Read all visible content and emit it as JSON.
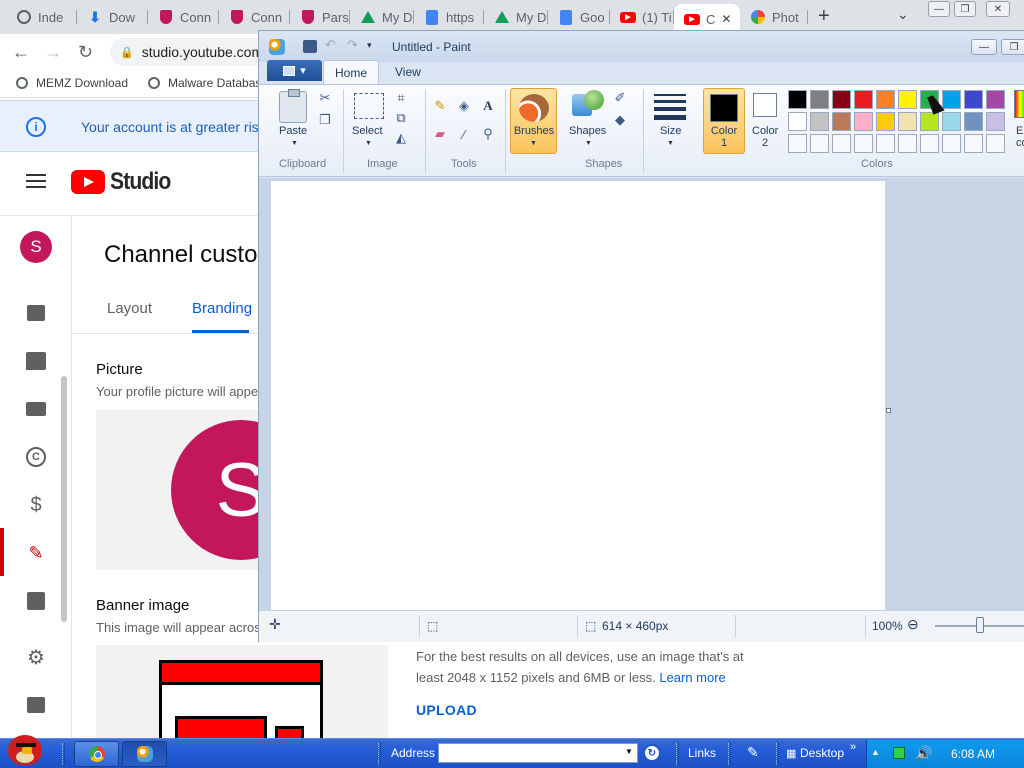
{
  "browser": {
    "tabs": [
      {
        "label": "Inde",
        "icon": "globe-icon"
      },
      {
        "label": "Dow",
        "icon": "download-icon"
      },
      {
        "label": "Conn",
        "icon": "shield-icon"
      },
      {
        "label": "Conn",
        "icon": "shield-icon"
      },
      {
        "label": "Pars",
        "icon": "shield-icon"
      },
      {
        "label": "My D",
        "icon": "drive-icon"
      },
      {
        "label": "https",
        "icon": "docs-icon"
      },
      {
        "label": "My D",
        "icon": "drive-icon"
      },
      {
        "label": "Goo",
        "icon": "docs-icon"
      },
      {
        "label": "(1) Ti",
        "icon": "youtube-icon"
      },
      {
        "label": "C",
        "icon": "youtube-icon",
        "active": true
      },
      {
        "label": "Phot",
        "icon": "photos-icon"
      }
    ],
    "new_tab": "+",
    "tab_menu": "⌄",
    "url": "studio.youtube.com",
    "bookmarks": [
      {
        "label": "MEMZ Download"
      },
      {
        "label": "Malware Databas"
      }
    ],
    "notice": "Your account is at greater risk"
  },
  "studio": {
    "logo_text": "Studio",
    "avatar_letter": "S",
    "page_title": "Channel custor",
    "tabs": [
      "Layout",
      "Branding"
    ],
    "active_tab": "Branding",
    "picture": {
      "heading": "Picture",
      "desc": "Your profile picture will appe",
      "letter": "S"
    },
    "banner": {
      "heading": "Banner image",
      "desc": "This image will appear acros",
      "best_results": "For the best results on all devices, use an image that's at least 2048 x 1152 pixels and 6MB or less.",
      "learn_more": "Learn more",
      "upload": "UPLOAD"
    },
    "rail_icons": [
      "dashboard-icon",
      "comments-icon",
      "subtitles-icon",
      "copyright-icon",
      "monetization-icon",
      "customization-icon",
      "audio-library-icon",
      "settings-icon",
      "feedback-icon"
    ]
  },
  "paint": {
    "title": "Untitled - Paint",
    "tabs": {
      "home": "Home",
      "view": "View"
    },
    "groups": {
      "clipboard": "Clipboard",
      "image": "Image",
      "tools": "Tools",
      "shapes": "Shapes",
      "colors": "Colors"
    },
    "buttons": {
      "paste": "Paste",
      "select": "Select",
      "brushes": "Brushes",
      "shapes": "Shapes",
      "size": "Size",
      "color1": "Color\n1",
      "color1_a": "Color",
      "color1_b": "1",
      "color2_a": "Color",
      "color2_b": "2",
      "edit_a": "E",
      "edit_b": "co"
    },
    "color1": "#000000",
    "color2": "#ffffff",
    "palette_row1": [
      "#000000",
      "#7f7f7f",
      "#880015",
      "#ed1c24",
      "#ff7f27",
      "#fff200",
      "#22b14c",
      "#00a2e8",
      "#3f48cc",
      "#a349a4"
    ],
    "palette_row2": [
      "#ffffff",
      "#c3c3c3",
      "#b97a57",
      "#ffaec9",
      "#ffc90e",
      "#efe4b0",
      "#b5e61d",
      "#99d9ea",
      "#7092be",
      "#c8bfe7"
    ],
    "palette_row3_count": 10,
    "status": {
      "canvas_size": "614 × 460px",
      "zoom": "100%",
      "zoom_level": 0.5
    }
  },
  "taskbar": {
    "address_label": "Address",
    "address_value": "",
    "links_label": "Links",
    "desktop_label": "Desktop",
    "clock": "6:08 AM"
  }
}
